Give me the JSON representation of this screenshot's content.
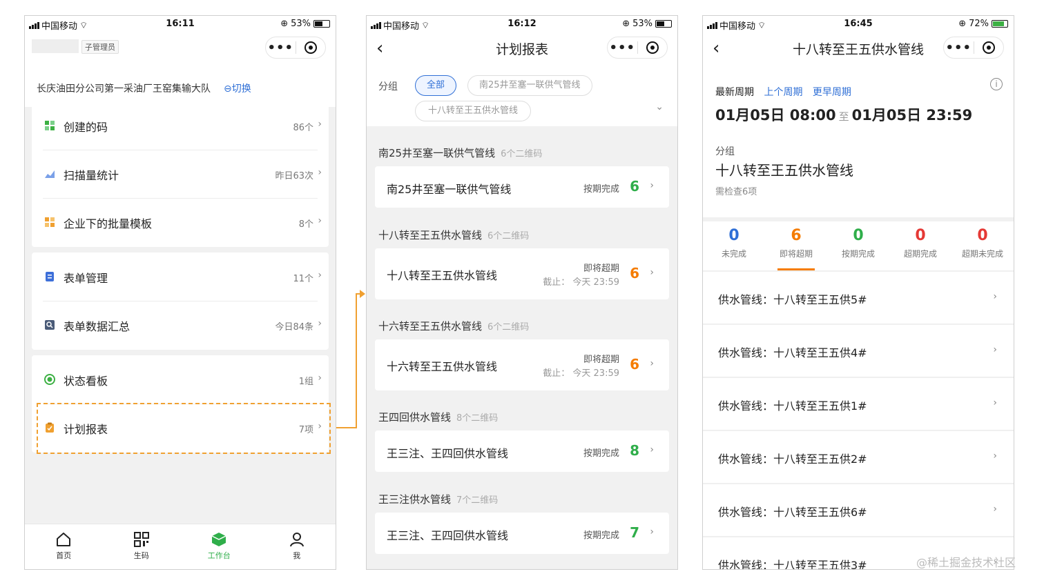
{
  "colors": {
    "accent_blue": "#2f6fd6",
    "green": "#2fae4a",
    "orange": "#f57c00",
    "highlight": "#f0a030"
  },
  "phone1": {
    "status": {
      "carrier": "中国移动",
      "time": "16:11",
      "battery": "53%"
    },
    "role": "子管理员",
    "org": "长庆油田分公司第一采油厂王窑集输大队",
    "switch_label": "切换",
    "menu": [
      {
        "label": "创建的码",
        "value": "86个",
        "icon": "qrcode-grid-icon"
      },
      {
        "label": "扫描量统计",
        "value": "昨日63次",
        "icon": "chart-icon"
      },
      {
        "label": "企业下的批量模板",
        "value": "8个",
        "icon": "template-icon"
      },
      {
        "label": "表单管理",
        "value": "11个",
        "icon": "form-icon"
      },
      {
        "label": "表单数据汇总",
        "value": "今日84条",
        "icon": "search-data-icon"
      },
      {
        "label": "状态看板",
        "value": "1组",
        "icon": "status-icon"
      },
      {
        "label": "计划报表",
        "value": "7项",
        "icon": "clipboard-icon"
      }
    ],
    "tabs": [
      {
        "label": "首页",
        "icon": "home-icon"
      },
      {
        "label": "生码",
        "icon": "qrcode-icon"
      },
      {
        "label": "工作台",
        "icon": "workbench-icon"
      },
      {
        "label": "我",
        "icon": "user-icon"
      }
    ]
  },
  "phone2": {
    "status": {
      "carrier": "中国移动",
      "time": "16:12",
      "battery": "53%"
    },
    "title": "计划报表",
    "filter_label": "分组",
    "chips": [
      "全部",
      "南25井至塞一联供气管线",
      "十八转至王五供水管线"
    ],
    "groups": [
      {
        "name": "南25井至塞一联供气管线",
        "count": "6个二维码",
        "plan": "南25井至塞一联供气管线",
        "status": "按期完成",
        "deadline": "",
        "num": "6",
        "num_color": "#2fae4a"
      },
      {
        "name": "十八转至王五供水管线",
        "count": "6个二维码",
        "plan": "十八转至王五供水管线",
        "status": "即将超期",
        "deadline": "截止：  今天 23:59",
        "num": "6",
        "num_color": "#f57c00"
      },
      {
        "name": "十六转至王五供水管线",
        "count": "6个二维码",
        "plan": "十六转至王五供水管线",
        "status": "即将超期",
        "deadline": "截止：  今天 23:59",
        "num": "6",
        "num_color": "#f57c00"
      },
      {
        "name": "王四回供水管线",
        "count": "8个二维码",
        "plan": "王三注、王四回供水管线",
        "status": "按期完成",
        "deadline": "",
        "num": "8",
        "num_color": "#2fae4a"
      },
      {
        "name": "王三注供水管线",
        "count": "7个二维码",
        "plan": "王三注、王四回供水管线",
        "status": "按期完成",
        "deadline": "",
        "num": "7",
        "num_color": "#2fae4a"
      }
    ]
  },
  "phone3": {
    "status": {
      "carrier": "中国移动",
      "time": "16:45",
      "battery": "72%"
    },
    "title": "十八转至王五供水管线",
    "period_tabs": [
      "最新周期",
      "上个周期",
      "更早周期"
    ],
    "range_start": "01月05日 08:00",
    "range_to": "至",
    "range_end": "01月05日 23:59",
    "group_label": "分组",
    "group_name": "十八转至王五供水管线",
    "need": "需检查6项",
    "stats": [
      {
        "n": "0",
        "t": "未完成",
        "color": "#2f6fd6"
      },
      {
        "n": "6",
        "t": "即将超期",
        "color": "#f57c00"
      },
      {
        "n": "0",
        "t": "按期完成",
        "color": "#2fae4a"
      },
      {
        "n": "0",
        "t": "超期完成",
        "color": "#e53935"
      },
      {
        "n": "0",
        "t": "超期未完成",
        "color": "#e53935"
      }
    ],
    "pipes": [
      "供水管线：十八转至王五供5#",
      "供水管线：十八转至王五供4#",
      "供水管线：十八转至王五供1#",
      "供水管线：十八转至王五供2#",
      "供水管线：十八转至王五供6#",
      "供水管线：十八转至王五供3#"
    ]
  },
  "watermark": "@稀土掘金技术社区"
}
